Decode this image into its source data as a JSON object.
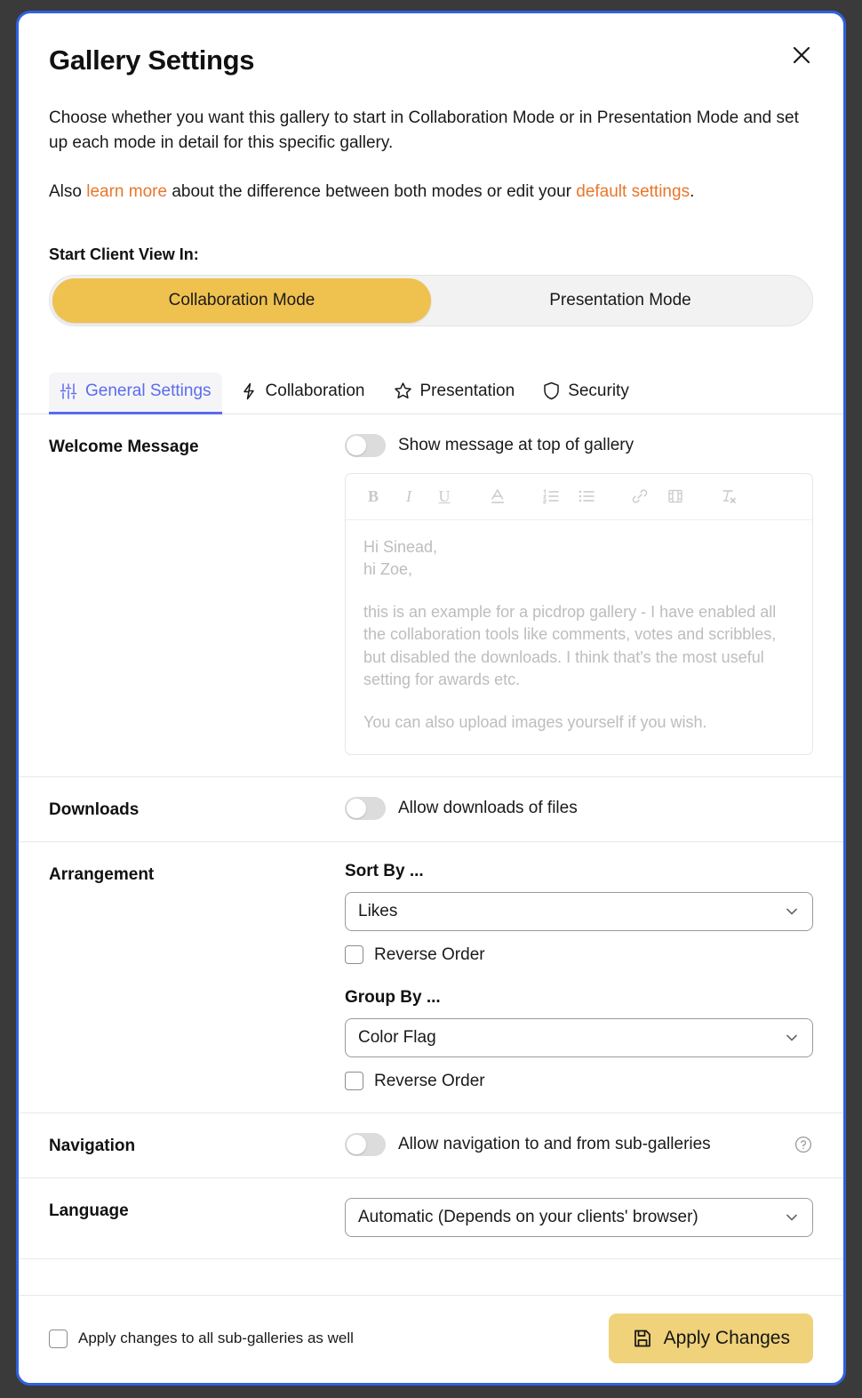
{
  "dialog": {
    "title": "Gallery Settings",
    "close_label": "close-icon"
  },
  "intro": {
    "paragraph1": "Choose whether you want this gallery to start in Collaboration Mode or in Presentation Mode and set up each mode in detail for this specific gallery.",
    "line2_prefix": "Also ",
    "link1": "learn more",
    "line2_middle": " about the difference between both modes or edit your ",
    "link2": "default settings",
    "line2_suffix": "."
  },
  "mode_switch": {
    "label": "Start Client View In:",
    "options": [
      {
        "label": "Collaboration Mode",
        "active": true
      },
      {
        "label": "Presentation Mode",
        "active": false
      }
    ]
  },
  "tabs": [
    {
      "label": "General Settings",
      "icon": "sliders-icon",
      "active": true
    },
    {
      "label": "Collaboration",
      "icon": "lightning-bolt-icon",
      "active": false
    },
    {
      "label": "Presentation",
      "icon": "star-icon",
      "active": false
    },
    {
      "label": "Security",
      "icon": "shield-icon",
      "active": false
    }
  ],
  "sections": {
    "welcome": {
      "label": "Welcome Message",
      "toggle_text": "Show message at top of gallery",
      "toggle_on": false,
      "toolbar": [
        {
          "name": "bold-icon",
          "glyph": "B"
        },
        {
          "name": "italic-icon",
          "glyph": "I"
        },
        {
          "name": "underline-icon",
          "glyph": "U"
        },
        {
          "name": "text-color-icon",
          "glyph": "A"
        },
        {
          "name": "numbered-list-icon",
          "glyph": ""
        },
        {
          "name": "bullet-list-icon",
          "glyph": ""
        },
        {
          "name": "link-icon",
          "glyph": ""
        },
        {
          "name": "video-icon",
          "glyph": ""
        },
        {
          "name": "clear-formatting-icon",
          "glyph": ""
        }
      ],
      "message_lines": [
        "Hi Sinead,",
        "hi Zoe,",
        "this is an example for a picdrop gallery - I have enabled all the collaboration tools like comments, votes and scribbles, but disabled the downloads. I think that's the most useful setting for awards etc.",
        "You can also upload images yourself if you wish."
      ]
    },
    "downloads": {
      "label": "Downloads",
      "toggle_text": "Allow downloads of files",
      "toggle_on": false
    },
    "arrangement": {
      "label": "Arrangement",
      "sort_label": "Sort By ...",
      "sort_value": "Likes",
      "sort_reverse_label": "Reverse Order",
      "sort_reverse_checked": false,
      "group_label": "Group By ...",
      "group_value": "Color Flag",
      "group_reverse_label": "Reverse Order",
      "group_reverse_checked": false
    },
    "navigation": {
      "label": "Navigation",
      "toggle_text": "Allow navigation to and from sub-galleries",
      "toggle_on": false,
      "help_icon": "help-circle-icon"
    },
    "language": {
      "label": "Language",
      "value": "Automatic (Depends on your clients' browser)"
    }
  },
  "footer": {
    "checkbox_label": "Apply changes to all sub-galleries as well",
    "checkbox_checked": false,
    "apply_label": "Apply Changes",
    "apply_icon": "save-icon"
  },
  "colors": {
    "accent_yellow": "#efc14e",
    "button_yellow": "#efd27a",
    "link_orange": "#e8762a",
    "tab_active_blue": "#5b6ced",
    "dialog_border_blue": "#2f62e0",
    "backdrop": "#3a3a3a"
  }
}
